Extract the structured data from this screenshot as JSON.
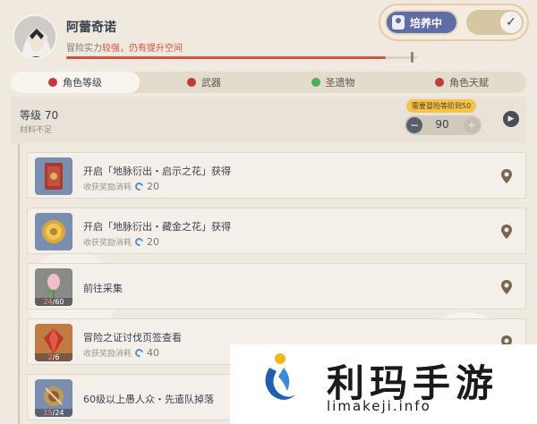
{
  "character": {
    "name": "阿蕾奇诺",
    "adventure_prefix": "冒险实力",
    "adventure_status": "较强，仍有提升空间",
    "progress_fraction": 0.91,
    "marker_fraction": 0.985
  },
  "training": {
    "badge_label": "培养中",
    "switch_on": true,
    "switch_glyph": "✓"
  },
  "tabs": [
    {
      "label": "角色等级",
      "active": true,
      "dot_color": "#c23a3a"
    },
    {
      "label": "武器",
      "active": false,
      "dot_color": "#c23a3a"
    },
    {
      "label": "圣遗物",
      "active": false,
      "dot_color": "#4caf50"
    },
    {
      "label": "角色天赋",
      "active": false,
      "dot_color": "#c23a3a"
    }
  ],
  "level": {
    "title": "等级 70",
    "subtitle": "材料不足",
    "requirement": "需要冒险等阶到50",
    "value": "90",
    "minus": "−",
    "plus": "+",
    "go": "▶"
  },
  "tasks": [
    {
      "title": "开启「地脉衍出・启示之花」获得",
      "cost_label": "收获奖励消耗",
      "cost": "20",
      "icon": "red-book-icon",
      "count_have": "",
      "count_need": ""
    },
    {
      "title": "开启「地脉衍出・藏金之花」获得",
      "cost_label": "收获奖励消耗",
      "cost": "20",
      "icon": "gold-coin-icon",
      "count_have": "",
      "count_need": ""
    },
    {
      "title": "前往采集",
      "cost_label": "",
      "cost": "",
      "icon": "pink-flower-icon",
      "count_have": "24",
      "count_need": "60"
    },
    {
      "title": "冒险之证讨伐页签查看",
      "cost_label": "收获奖励消耗",
      "cost": "40",
      "icon": "red-gem-icon",
      "count_have": "2",
      "count_need": "6"
    },
    {
      "title": "60级以上愚人众・先遣队掉落",
      "cost_label": "",
      "cost": "",
      "icon": "insignia-icon",
      "count_have": "15",
      "count_need": "24"
    }
  ],
  "watermark": {
    "title": "利玛手游",
    "url": "limakeji.info"
  },
  "colors": {
    "accent_red": "#d9503f",
    "badge_blue": "#5e6ca8",
    "switch_gold": "#d6c6a4",
    "requirement_yellow": "#f1c34f"
  }
}
